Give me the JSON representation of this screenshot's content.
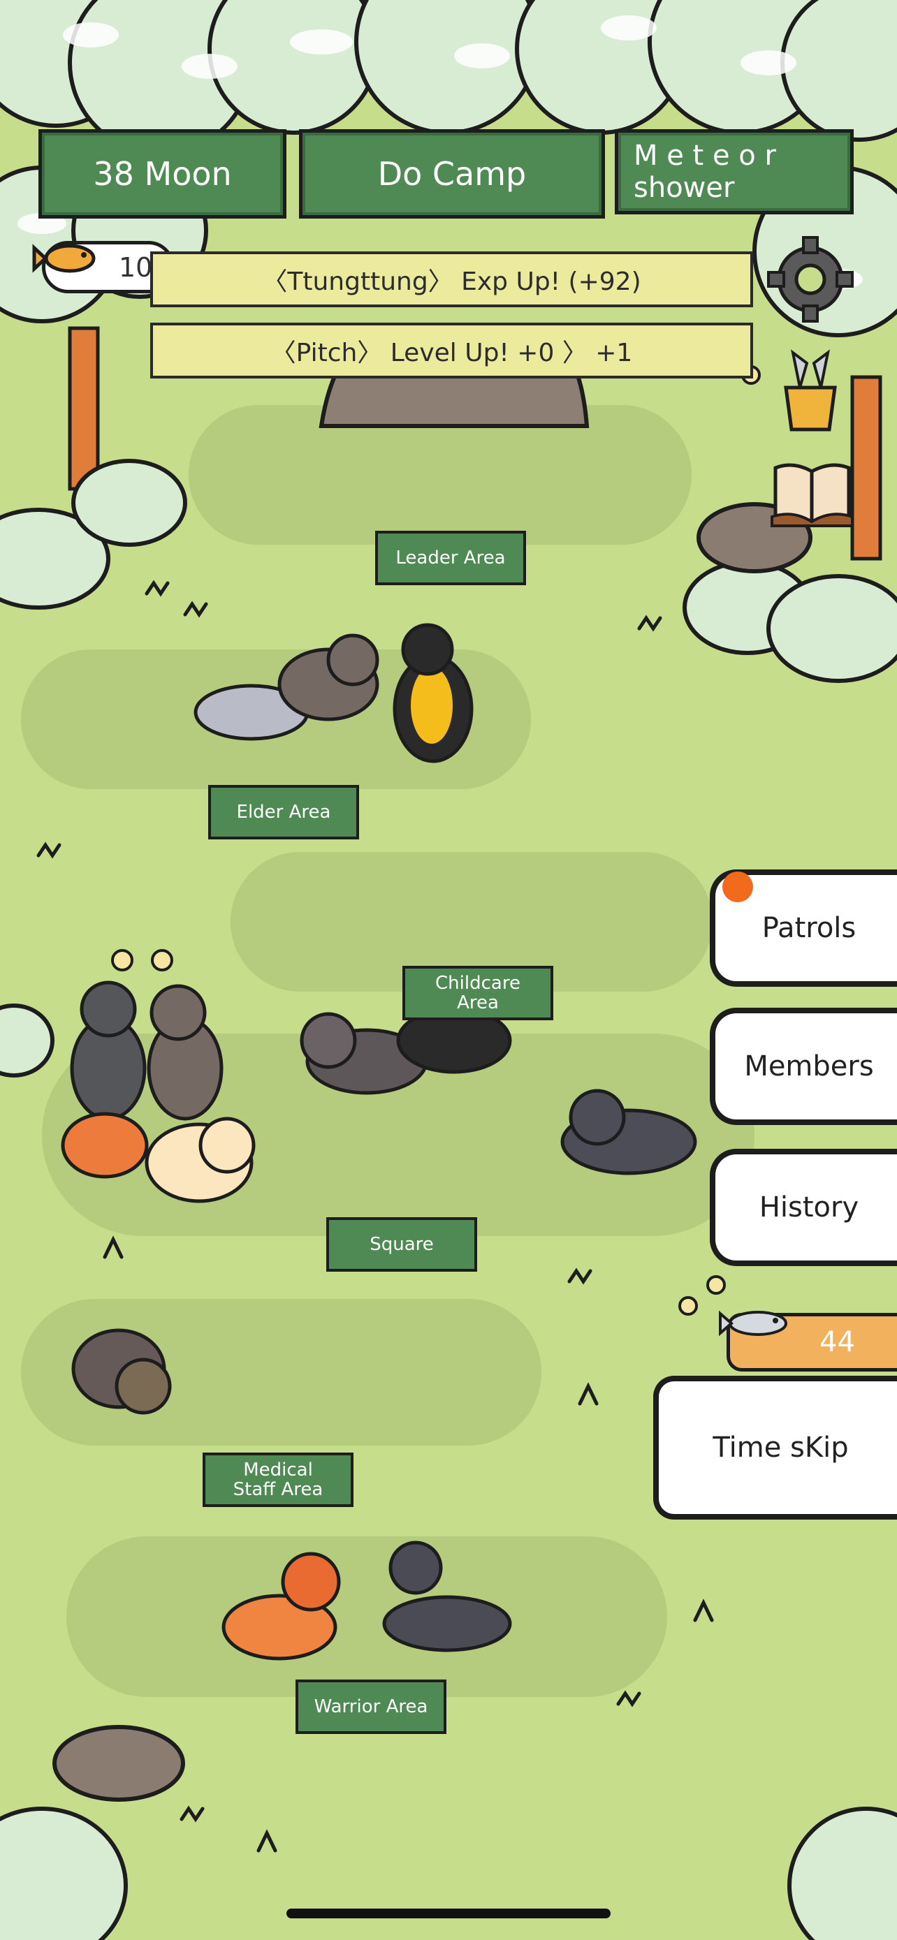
{
  "hud": {
    "moon": "38 Moon",
    "phase": "Do Camp",
    "weather_line1": "M e t e o r",
    "weather_line2": "shower",
    "fish_count": "10"
  },
  "notifications": [
    "〈Ttungttung〉 Exp Up! (+92)",
    "〈Pitch〉 Level Up! +0 〉 +1"
  ],
  "areas": {
    "leader": "Leader Area",
    "elder": "Elder Area",
    "childcare": "Childcare Area",
    "square": "Square",
    "medical": "Medical Staff Area",
    "warrior": "Warrior Area"
  },
  "menu": {
    "patrols": "Patrols",
    "members": "Members",
    "history": "History",
    "fish_stock": "44",
    "time_skip": "Time sKip"
  },
  "icons": [
    "fish-icon",
    "gear-icon",
    "fish-bucket-icon",
    "book-icon",
    "notification-dot-icon"
  ],
  "colors": {
    "grass": "#c6dd8c",
    "hud_green": "#4f8a55",
    "notice_yellow": "#ecea9c",
    "fish_badge": "#f2b15c",
    "alert_dot": "#f26a1b"
  }
}
